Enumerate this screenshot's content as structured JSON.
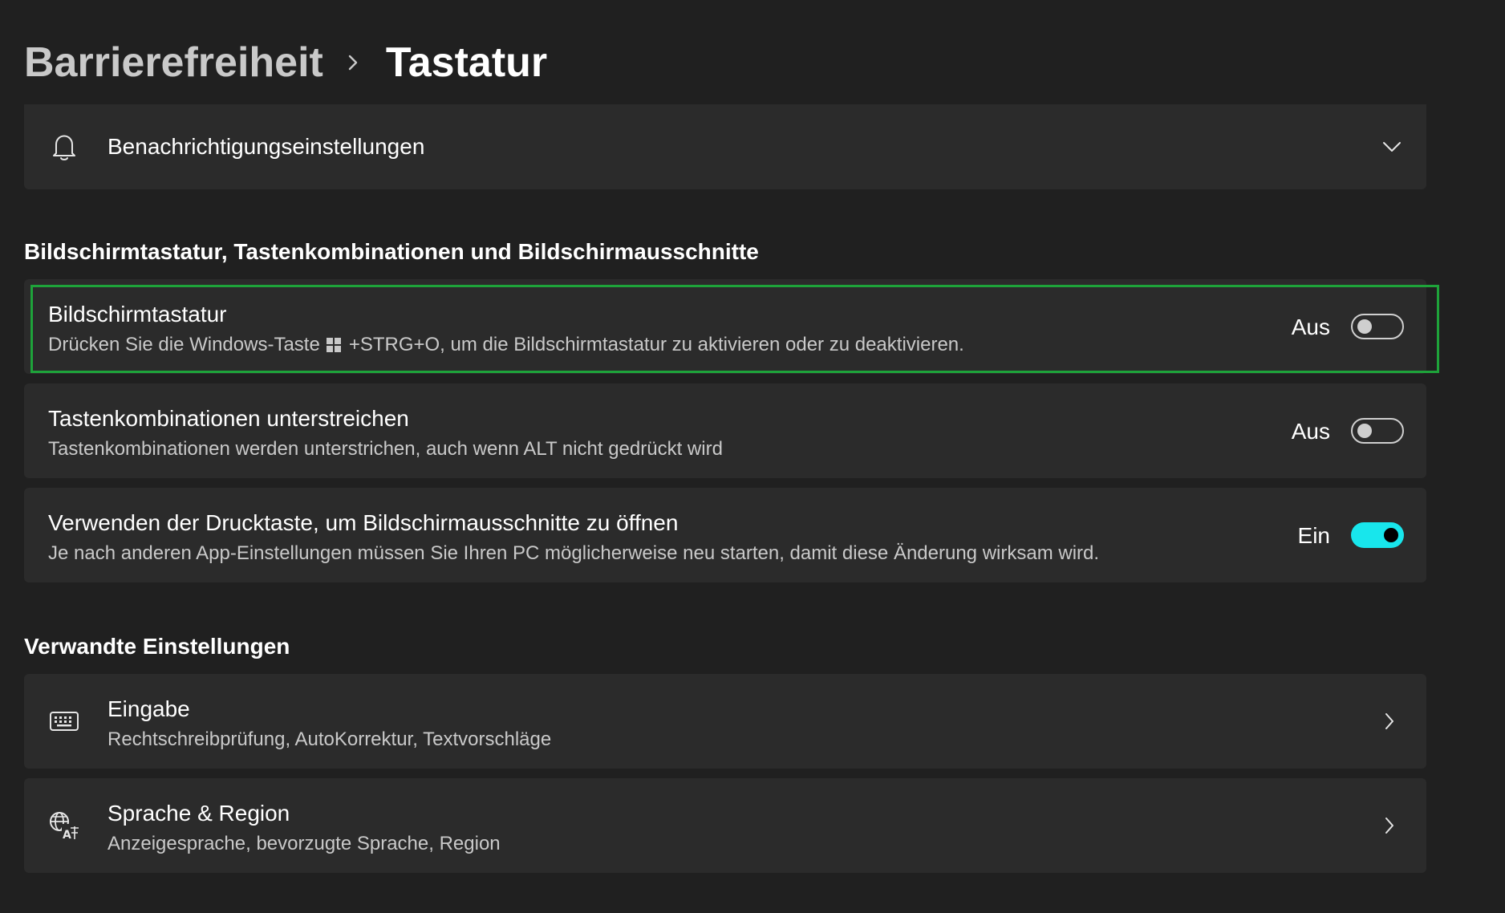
{
  "breadcrumb": {
    "parent": "Barrierefreiheit",
    "current": "Tastatur"
  },
  "notifications": {
    "label": "Benachrichtigungseinstellungen",
    "icon": "bell-icon"
  },
  "section_keyboard": {
    "title": "Bildschirmtastatur, Tastenkombinationen und Bildschirmausschnitte",
    "items": [
      {
        "title": "Bildschirmtastatur",
        "desc_before": "Drücken Sie die Windows-Taste",
        "desc_after": "+STRG+O, um die Bildschirmtastatur zu aktivieren oder zu deaktivieren.",
        "state": "Aus",
        "on": false
      },
      {
        "title": "Tastenkombinationen unterstreichen",
        "desc": "Tastenkombinationen werden unterstrichen, auch wenn ALT nicht gedrückt wird",
        "state": "Aus",
        "on": false
      },
      {
        "title": "Verwenden der Drucktaste, um Bildschirmausschnitte zu öffnen",
        "desc": "Je nach anderen App-Einstellungen müssen Sie Ihren PC möglicherweise neu starten, damit diese Änderung wirksam wird.",
        "state": "Ein",
        "on": true
      }
    ]
  },
  "section_related": {
    "title": "Verwandte Einstellungen",
    "items": [
      {
        "title": "Eingabe",
        "desc": "Rechtschreibprüfung, AutoKorrektur, Textvorschläge",
        "icon": "keyboard-icon"
      },
      {
        "title": "Sprache & Region",
        "desc": "Anzeigesprache, bevorzugte Sprache, Region",
        "icon": "language-icon"
      }
    ]
  },
  "colors": {
    "background": "#202020",
    "card": "#2b2b2b",
    "accent": "#18e6ec",
    "highlight": "#1ea33a"
  }
}
